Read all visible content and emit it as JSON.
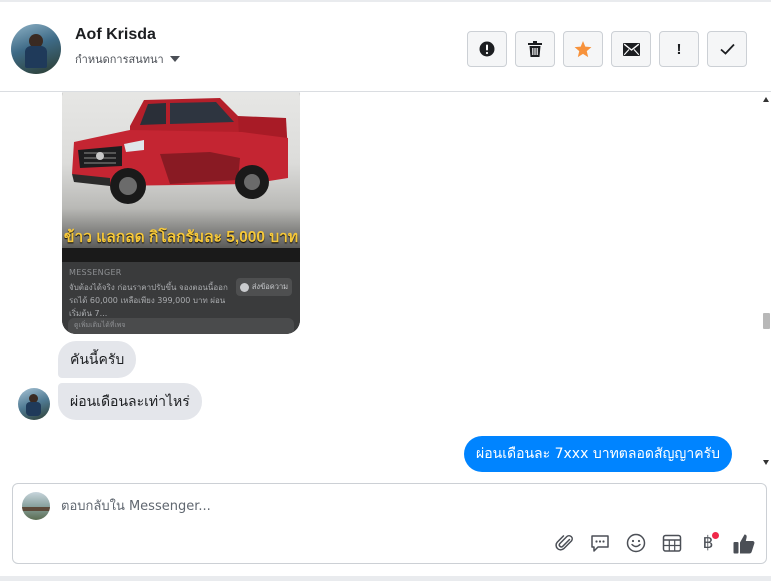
{
  "header": {
    "contact_name": "Aof Krisda",
    "assign_label": "กำหนดการสนทนา",
    "actions": [
      {
        "name": "spam",
        "icon": "alert-circle-icon"
      },
      {
        "name": "delete",
        "icon": "trash-icon"
      },
      {
        "name": "star",
        "icon": "star-icon",
        "color": "#f7923b"
      },
      {
        "name": "mark-unread",
        "icon": "envelope-icon"
      },
      {
        "name": "follow-up",
        "icon": "exclamation-icon",
        "label": "!"
      },
      {
        "name": "mark-done",
        "icon": "check-icon"
      }
    ]
  },
  "conversation": {
    "shared_post": {
      "promo_text": "ข้าว แลกลด กิโลกรัมละ 5,000 บาท",
      "source": "MESSENGER",
      "description": "จับต้องได้จริง ก่อนราคาปรับขึ้น จองตอนนี้ออกรถได้ 60,000 เหลือเพียง 399,000 บาท ผ่อนเริ่มต้น 7...",
      "cta_label": "ส่งข้อความ",
      "footer_text": "ดูเพิ่มเติมได้ที่เพจ"
    },
    "messages": [
      {
        "direction": "in",
        "text": "คันนี้ครับ"
      },
      {
        "direction": "in",
        "text": "ผ่อนเดือนละเท่าไหร่"
      },
      {
        "direction": "out",
        "text": "ผ่อนเดือนละ 7xxx บาทตลอดสัญญาครับ"
      }
    ]
  },
  "composer": {
    "placeholder": "ตอบกลับใน Messenger...",
    "tools": [
      "paperclip-icon",
      "saved-reply-icon",
      "emoji-icon",
      "appointment-icon",
      "baht-icon",
      "thumbs-up-icon"
    ],
    "baht_symbol": "฿"
  },
  "colors": {
    "outgoing_bubble": "#0084ff",
    "incoming_bubble": "#e4e6eb",
    "star": "#f7923b",
    "notification_dot": "#f02849"
  }
}
